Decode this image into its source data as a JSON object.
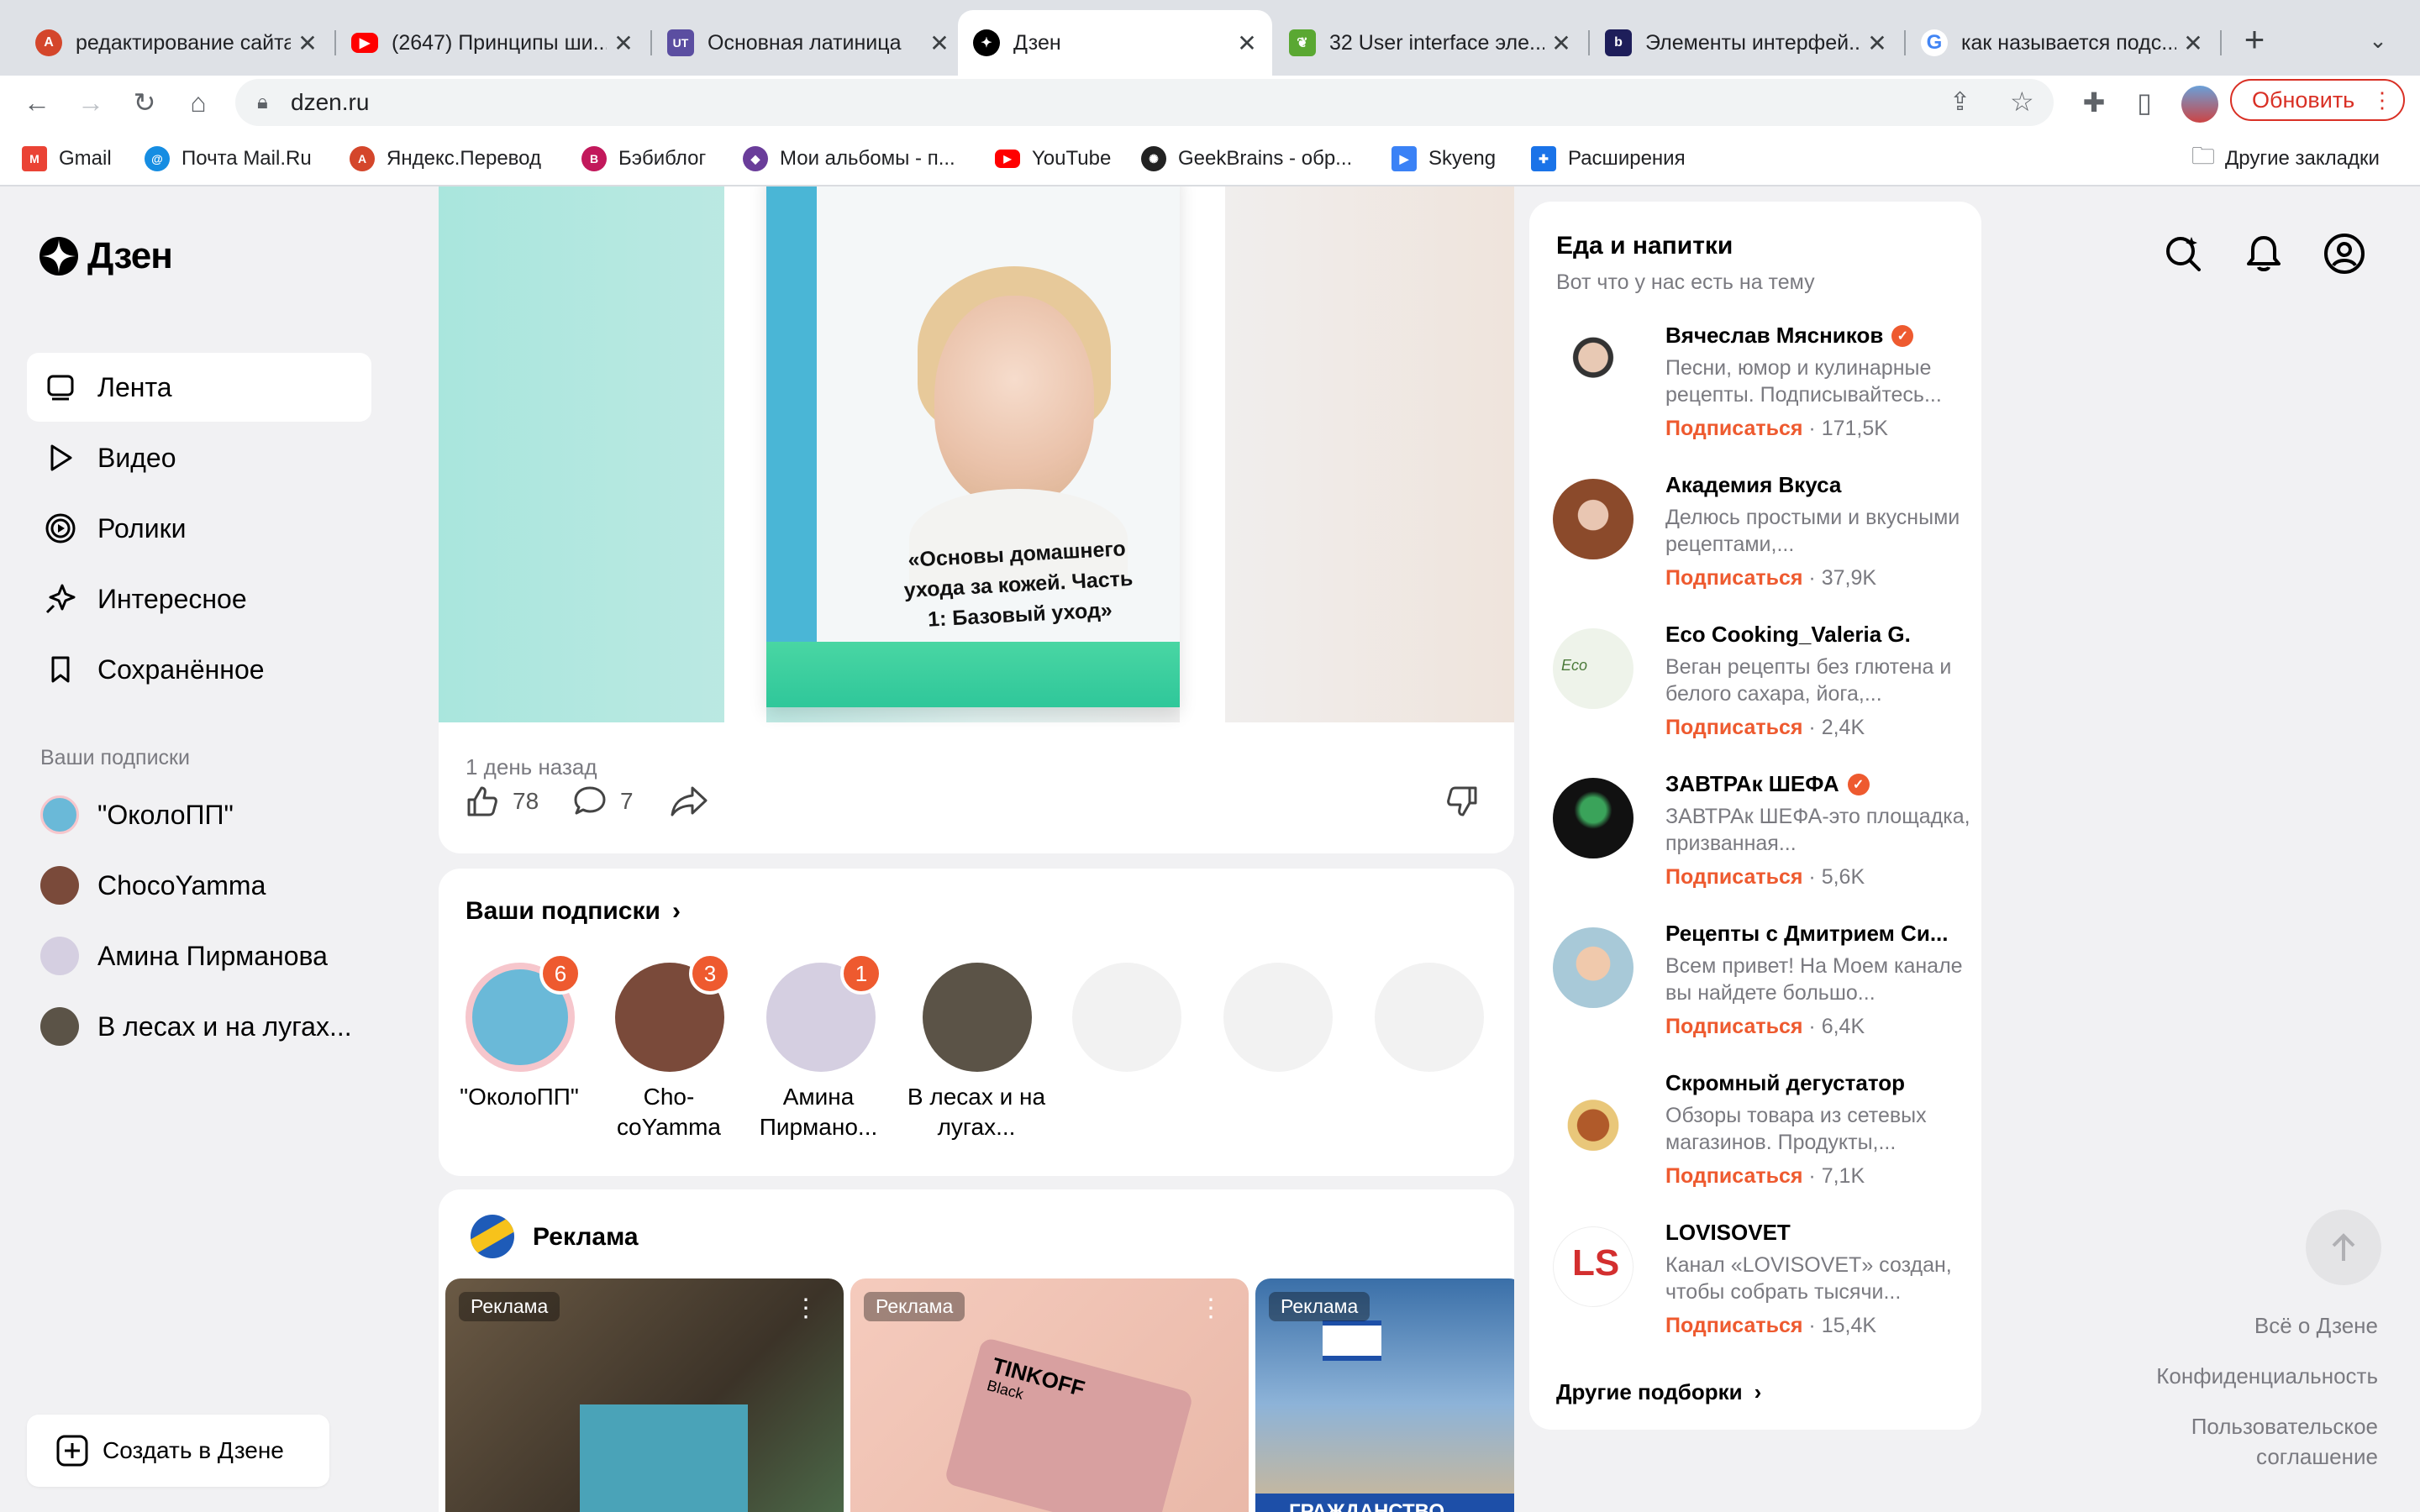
{
  "browser": {
    "tabs": [
      {
        "title": "редактирование сайта",
        "icon": "avatar-icon",
        "color": "#d4462b"
      },
      {
        "title": "(2647) Принципы ши...",
        "icon": "youtube-icon",
        "color": "#ff0000"
      },
      {
        "title": "Основная латиница",
        "icon": "ut-icon",
        "color": "#5b4ea1"
      },
      {
        "title": "Дзен",
        "icon": "dzen-icon",
        "color": "#000000",
        "active": true
      },
      {
        "title": "32 User interface эле...",
        "icon": "leaf-icon",
        "color": "#5aa832"
      },
      {
        "title": "Элементы интерфей...",
        "icon": "b-icon",
        "color": "#1e1e5a"
      },
      {
        "title": "как называется подс...",
        "icon": "google-icon",
        "color": "#4285f4"
      }
    ],
    "new_tab": "+",
    "url": "dzen.ru",
    "update_label": "Обновить",
    "bookmarks": [
      {
        "label": "Gmail",
        "icon": "gmail-icon",
        "color": "#ea4335"
      },
      {
        "label": "Почта Mail.Ru",
        "icon": "at-icon",
        "color": "#168de2"
      },
      {
        "label": "Яндекс.Перевод",
        "icon": "translate-icon",
        "color": "#d4462b"
      },
      {
        "label": "Бэбиблог",
        "icon": "babyblog-icon",
        "color": "#c2185b"
      },
      {
        "label": "Мои альбомы - п...",
        "icon": "album-icon",
        "color": "#6a3d9a"
      },
      {
        "label": "YouTube",
        "icon": "youtube-icon",
        "color": "#ff0000"
      },
      {
        "label": "GeekBrains - обр...",
        "icon": "geekbrains-icon",
        "color": "#222222"
      },
      {
        "label": "Skyeng",
        "icon": "skyeng-icon",
        "color": "#3b82f6"
      },
      {
        "label": "Расширения",
        "icon": "puzzle-icon",
        "color": "#1a73e8"
      }
    ],
    "other_bookmarks": "Другие закладки"
  },
  "sidebar": {
    "logo": "Дзен",
    "nav": [
      {
        "label": "Лента",
        "icon": "feed-icon",
        "active": true
      },
      {
        "label": "Видео",
        "icon": "play-icon"
      },
      {
        "label": "Ролики",
        "icon": "shorts-icon"
      },
      {
        "label": "Интересное",
        "icon": "sparkle-icon"
      },
      {
        "label": "Сохранённое",
        "icon": "bookmark-icon"
      }
    ],
    "subs_heading": "Ваши подписки",
    "subs": [
      {
        "label": "\"ОколоПП\"",
        "color": "#6ab9d8"
      },
      {
        "label": "ChocoYamma",
        "color": "#7a4a3a"
      },
      {
        "label": "Амина Пирманова",
        "color": "#c9c2d8"
      },
      {
        "label": "В лесах и на лугах...",
        "color": "#5b5347"
      }
    ],
    "create_label": "Создать в Дзене"
  },
  "post": {
    "book_title": "«Основы домашнего ухода за кожей. Часть 1: Базовый уход»",
    "time": "1 день назад",
    "likes": "78",
    "comments": "7"
  },
  "subs_card": {
    "title": "Ваши подписки",
    "items": [
      {
        "label": "\"ОколоПП\"",
        "badge": "6",
        "color": "#6ab9d8"
      },
      {
        "label": "Cho-coYamma",
        "badge": "3",
        "color": "#7a4a3a"
      },
      {
        "label": "Амина Пирмано...",
        "badge": "1",
        "color": "#d5cfe1"
      },
      {
        "label": "В лесах и на лугах...",
        "color": "#5b5347"
      }
    ]
  },
  "ads": {
    "title": "Реклама",
    "tag": "Реклама",
    "items": [
      {
        "tag": "Реклама",
        "color": "#5a4f3f"
      },
      {
        "tag": "Реклама",
        "color": "#e9b8a8",
        "brand": "TINKOFF",
        "sub": "Black"
      },
      {
        "tag": "Реклама",
        "color": "#3a6fa8",
        "caption": "ГРАЖДАНСТВО"
      }
    ]
  },
  "food": {
    "title": "Еда и напитки",
    "subtitle": "Вот что у нас есть на тему",
    "subscribe": "Подписаться",
    "channels": [
      {
        "name": "Вячеслав Мясников",
        "verified": true,
        "desc": "Песни, юмор и кулинарные рецепты. Подписывайтесь...",
        "count": "171,5K",
        "color": "#c9c9c9"
      },
      {
        "name": "Академия Вкуса",
        "desc": "Делюсь простыми и вкусными рецептами,...",
        "count": "37,9K",
        "color": "#b07a5a"
      },
      {
        "name": "Eco Cooking_Valeria G.",
        "desc": "Веган рецепты без глютена и белого сахара, йога,...",
        "count": "2,4K",
        "color": "#eef3ea"
      },
      {
        "name": "ЗАВТРАк ШЕФА",
        "verified": true,
        "desc": "ЗАВТРАк ШЕФА-это площадка, призванная...",
        "count": "5,6K",
        "color": "#111111"
      },
      {
        "name": "Рецепты с Дмитрием Си...",
        "desc": "Всем привет! На Моем канале вы найдете большо...",
        "count": "6,4K",
        "color": "#a8c9d8"
      },
      {
        "name": "Скромный дегустатор",
        "desc": "Обзоры товара из сетевых магазинов. Продукты,...",
        "count": "7,1K",
        "color": "#e9c77a"
      },
      {
        "name": "LOVISOVET",
        "desc": "Канал «LOVISOVET» создан, чтобы собрать тысячи...",
        "count": "15,4K",
        "color": "#ffffff"
      }
    ],
    "more": "Другие подборки"
  },
  "footer": {
    "about": "Всё о Дзене",
    "privacy": "Конфиденциальность",
    "agreement": "Пользовательское соглашение"
  }
}
